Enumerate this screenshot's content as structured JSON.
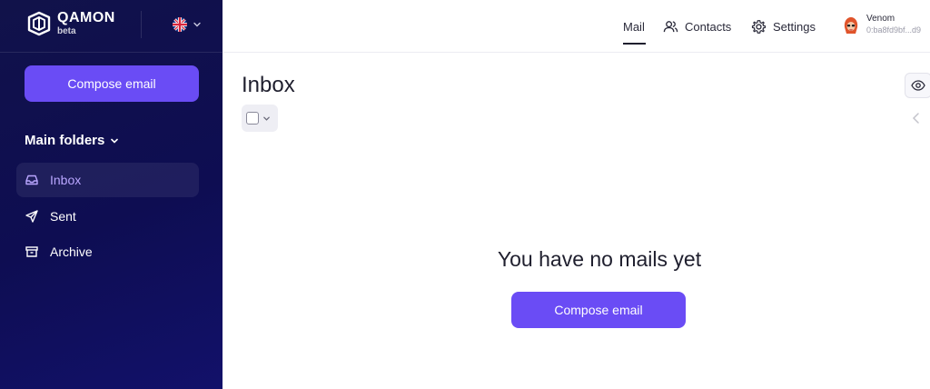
{
  "brand": {
    "name": "QAMON",
    "tag": "beta"
  },
  "sidebar": {
    "compose_label": "Compose email",
    "folders_title": "Main folders",
    "items": [
      {
        "label": "Inbox",
        "icon": "inbox-icon",
        "active": true
      },
      {
        "label": "Sent",
        "icon": "send-icon",
        "active": false
      },
      {
        "label": "Archive",
        "icon": "archive-icon",
        "active": false
      }
    ]
  },
  "header": {
    "tabs": [
      {
        "label": "Mail",
        "active": true
      },
      {
        "label": "Contacts",
        "icon": "contacts-icon"
      },
      {
        "label": "Settings",
        "icon": "gear-icon"
      }
    ],
    "user": {
      "name": "Venom",
      "address": "0:ba8fd9bf...d9"
    }
  },
  "main": {
    "title": "Inbox",
    "empty_message": "You have no mails yet",
    "compose_label": "Compose email"
  },
  "colors": {
    "accent": "#6a4cf5",
    "sidebar_bg": "#0e0d52",
    "active_item_text": "#b9a6ff"
  }
}
